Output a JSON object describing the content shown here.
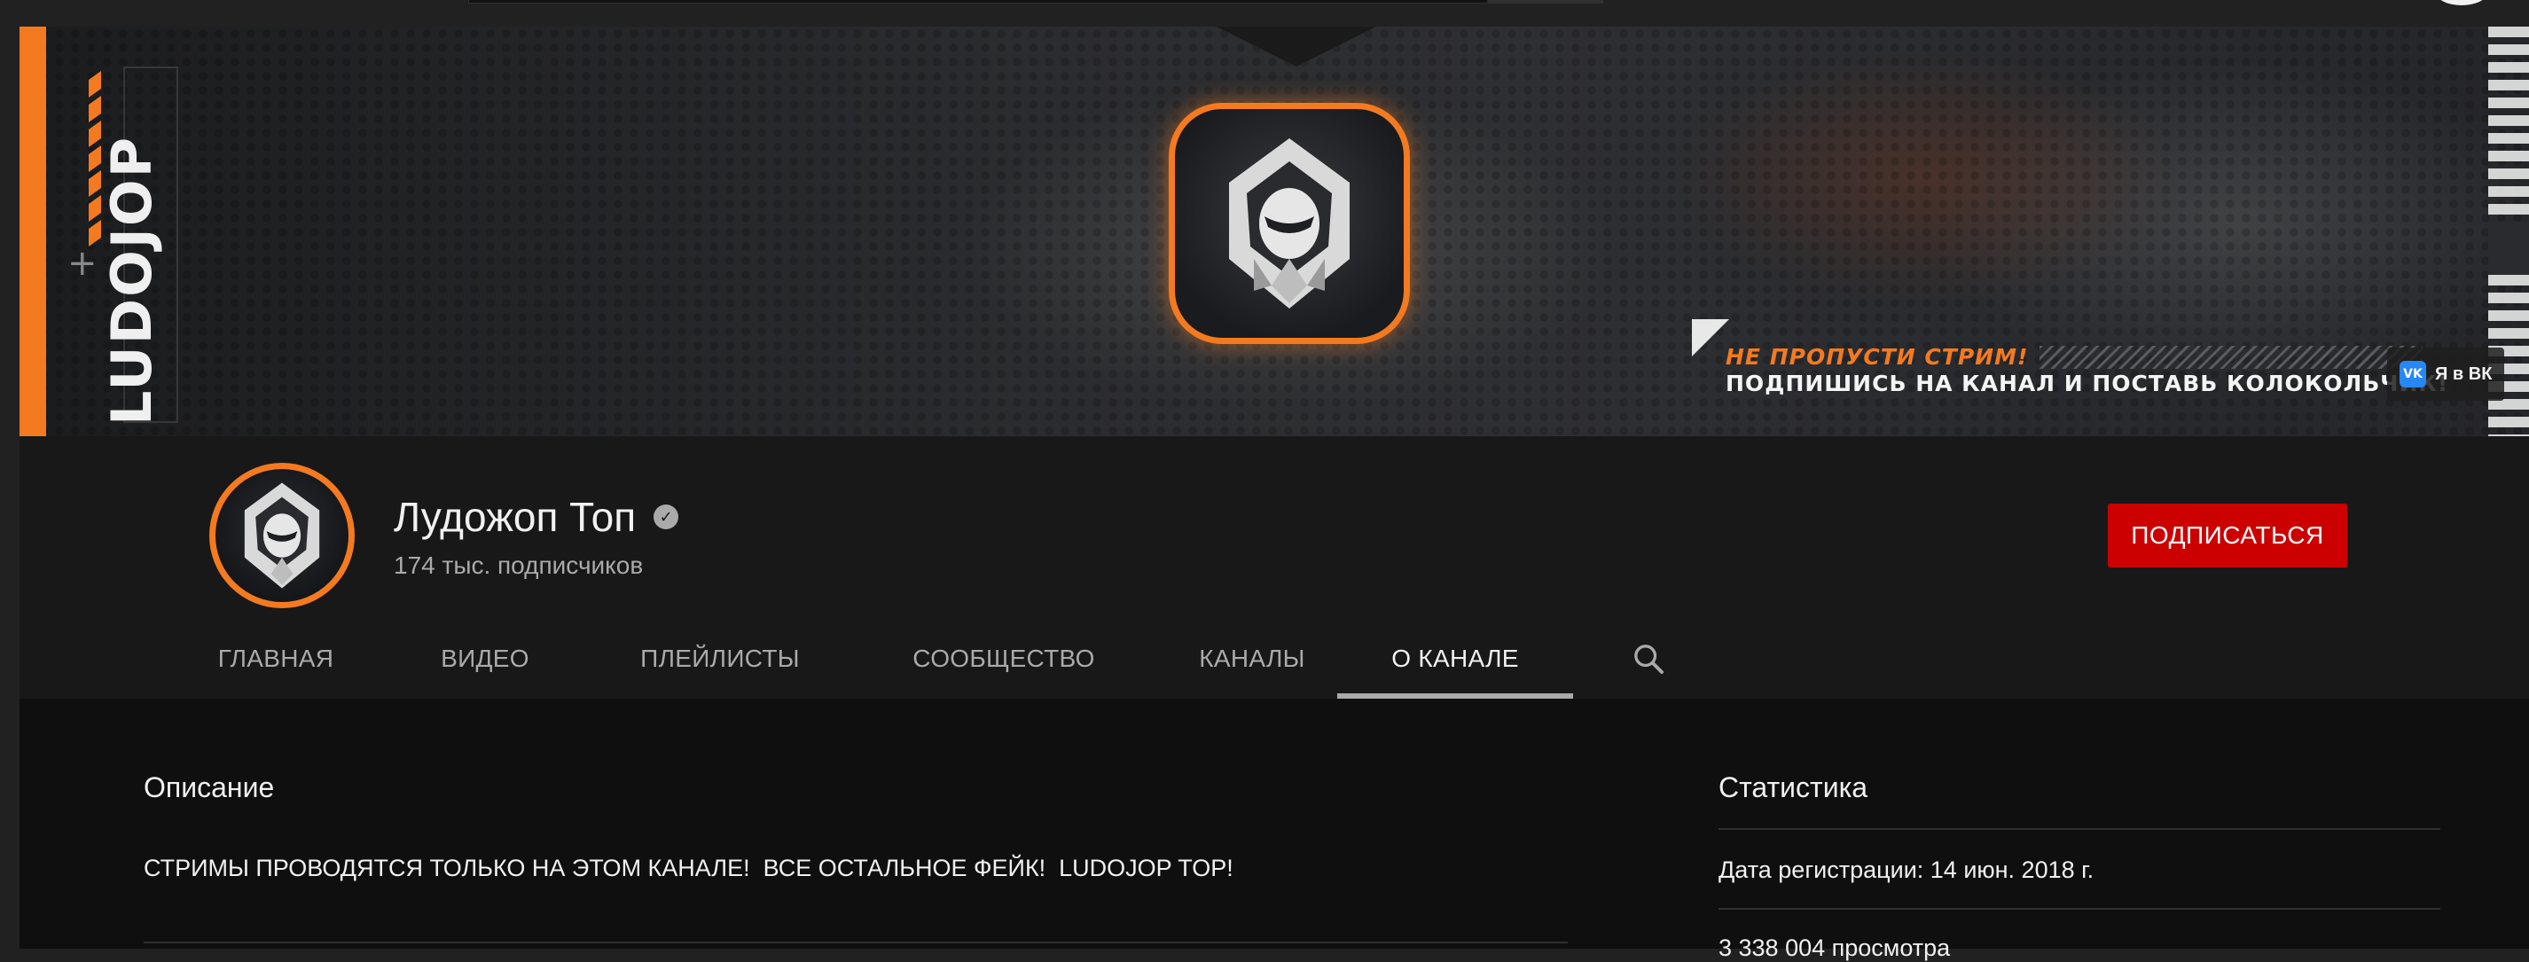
{
  "banner": {
    "brand_text": "LUDOJOP",
    "promo_line1": "НЕ ПРОПУСТИ СТРИМ!",
    "promo_line2": "ПОДПИШИСЬ НА КАНАЛ И ПОСТАВЬ КОЛОКОЛЬЧИК!",
    "vk_icon_text": "VK",
    "vk_link_label": "Я в ВК"
  },
  "channel": {
    "name": "Лудожоп Топ",
    "verified_glyph": "✓",
    "subscribers": "174 тыс. подписчиков",
    "subscribe_label": "ПОДПИСАТЬСЯ"
  },
  "tabs": [
    {
      "label": "ГЛАВНАЯ"
    },
    {
      "label": "ВИДЕО"
    },
    {
      "label": "ПЛЕЙЛИСТЫ"
    },
    {
      "label": "СООБЩЕСТВО"
    },
    {
      "label": "КАНАЛЫ"
    },
    {
      "label": "О КАНАЛЕ"
    }
  ],
  "active_tab": "О КАНАЛЕ",
  "about": {
    "description_heading": "Описание",
    "description_text": "СТРИМЫ ПРОВОДЯТСЯ ТОЛЬКО НА ЭТОМ КАНАЛЕ!  ВСЕ ОСТАЛЬНОЕ ФЕЙК!  LUDOJOP TOP!",
    "stats_heading": "Статистика",
    "joined": "Дата регистрации: 14 июн. 2018 г.",
    "views": "3 338 004 просмотра"
  },
  "colors": {
    "accent": "#f47a20",
    "subscribe": "#cc0000",
    "background": "#181818",
    "content_bg": "#0f0f0f"
  },
  "icons": [
    "search-icon",
    "verified-icon",
    "vk-icon",
    "hooded-figure-logo"
  ]
}
